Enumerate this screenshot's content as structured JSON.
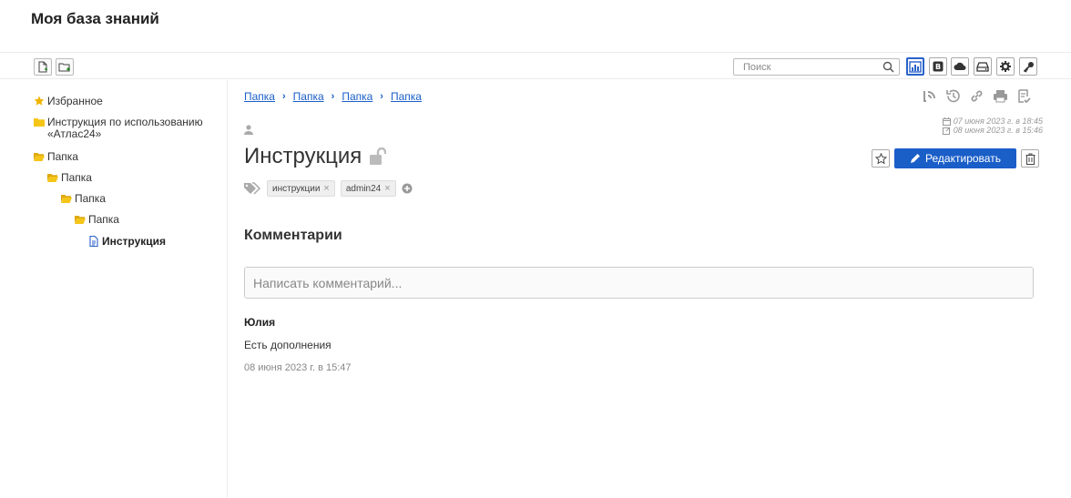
{
  "app": {
    "title": "Моя база знаний"
  },
  "toolbar": {
    "new_doc_icon": "file-plus-icon",
    "new_folder_icon": "folder-plus-icon",
    "search_placeholder": "Поиск",
    "icons": [
      "chart-icon",
      "blog-icon",
      "cloud-icon",
      "drive-icon",
      "gear-icon",
      "key-icon"
    ]
  },
  "sidebar": {
    "items": [
      {
        "label": "Избранное",
        "icon": "star-icon"
      },
      {
        "label": "Инструкция по использованию «Атлас24»",
        "icon": "folder-icon"
      },
      {
        "label": "Папка",
        "icon": "folder-open-icon"
      },
      {
        "label": "Папка",
        "icon": "folder-open-icon"
      },
      {
        "label": "Папка",
        "icon": "folder-open-icon"
      },
      {
        "label": "Папка",
        "icon": "folder-open-icon"
      },
      {
        "label": "Инструкция",
        "icon": "document-icon"
      }
    ]
  },
  "breadcrumb": [
    "Папка",
    "Папка",
    "Папка",
    "Папка"
  ],
  "document": {
    "title": "Инструкция",
    "created": "07 июня 2023 г. в 18:45",
    "modified": "08 июня 2023 г. в 15:46",
    "edit_label": "Редактировать",
    "tags": [
      "инструкции",
      "admin24"
    ]
  },
  "comments": {
    "heading": "Комментарии",
    "input_placeholder": "Написать комментарий...",
    "items": [
      {
        "author": "Юлия",
        "text": "Есть дополнения",
        "date": "08 июня 2023 г. в 15:47"
      }
    ]
  },
  "colors": {
    "accent": "#1a5ec8",
    "folder": "#f5c518",
    "star": "#f0b400"
  }
}
